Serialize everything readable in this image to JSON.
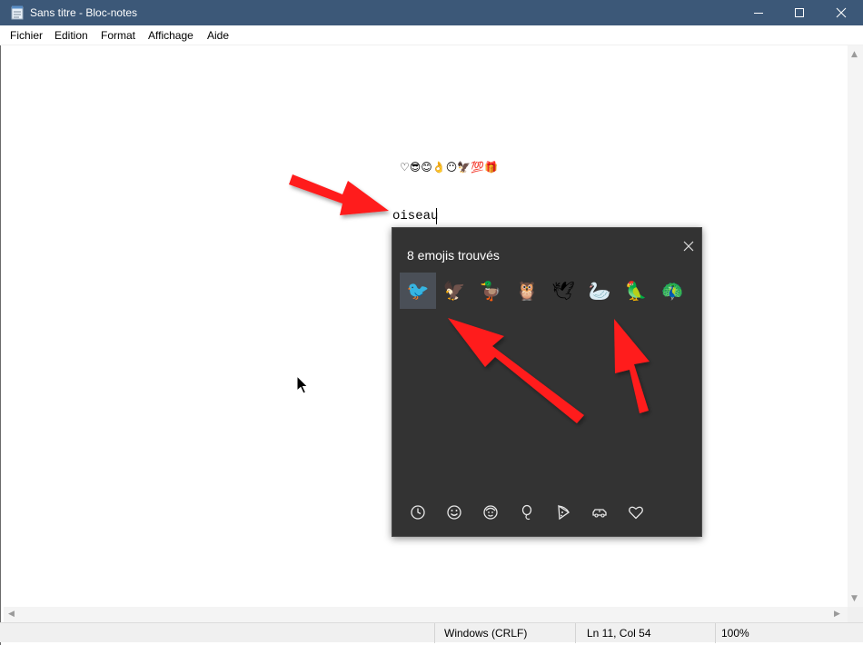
{
  "window": {
    "title": "Sans titre - Bloc-notes"
  },
  "menu": {
    "items": [
      "Fichier",
      "Edition",
      "Format",
      "Affichage",
      "Aide"
    ]
  },
  "document": {
    "emoji_line": "♡😎😊👌😶🦅💯🎁",
    "typed_text": "oiseau"
  },
  "emoji_panel": {
    "count_label": "8 emojis trouvés",
    "emojis": [
      "🐦",
      "🦅",
      "🦆",
      "🦉",
      "🕊",
      "🦢",
      "🦜",
      "🦚"
    ],
    "selected_index": 0,
    "categories": [
      "clock-icon",
      "smiley-icon",
      "people-icon",
      "balloon-icon",
      "pizza-icon",
      "car-icon",
      "heart-icon"
    ]
  },
  "status": {
    "line_ending": "Windows (CRLF)",
    "position": "Ln 11, Col 54",
    "zoom": "100%"
  },
  "colors": {
    "title_bar": "#3c5878",
    "panel_bg": "#333333",
    "annotation_red": "#ff1a1a"
  }
}
